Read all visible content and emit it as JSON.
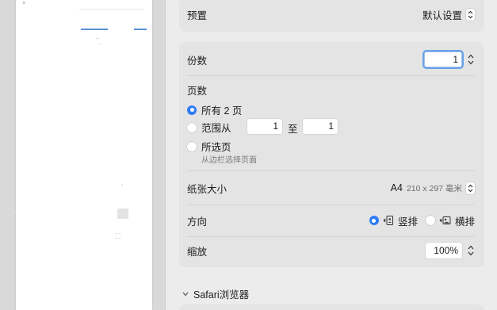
{
  "preview": {
    "marks": [
      "x",
      "· ---- ·",
      "---- ·",
      "---- -- ·",
      "--- -- ·"
    ]
  },
  "presets": {
    "label": "预置",
    "value": "默认设置"
  },
  "copies": {
    "label": "份数",
    "value": "1"
  },
  "pages": {
    "label": "页数",
    "all_label": "所有 2 页",
    "range_label": "范围从",
    "range_from": "1",
    "range_to_label": "至",
    "range_to": "1",
    "selected_label": "所选页",
    "selected_hint": "从边栏选择页面"
  },
  "paper_size": {
    "label": "纸张大小",
    "value": "A4",
    "detail": "210 x 297 毫米"
  },
  "orientation": {
    "label": "方向",
    "portrait_label": "竖排",
    "landscape_label": "横排",
    "selected": "portrait"
  },
  "scale": {
    "label": "缩放",
    "value": "100%"
  },
  "safari_section": {
    "label": "Safari浏览器"
  },
  "colors": {
    "accent": "#2f7cf6",
    "focus": "#6aa0e8"
  }
}
